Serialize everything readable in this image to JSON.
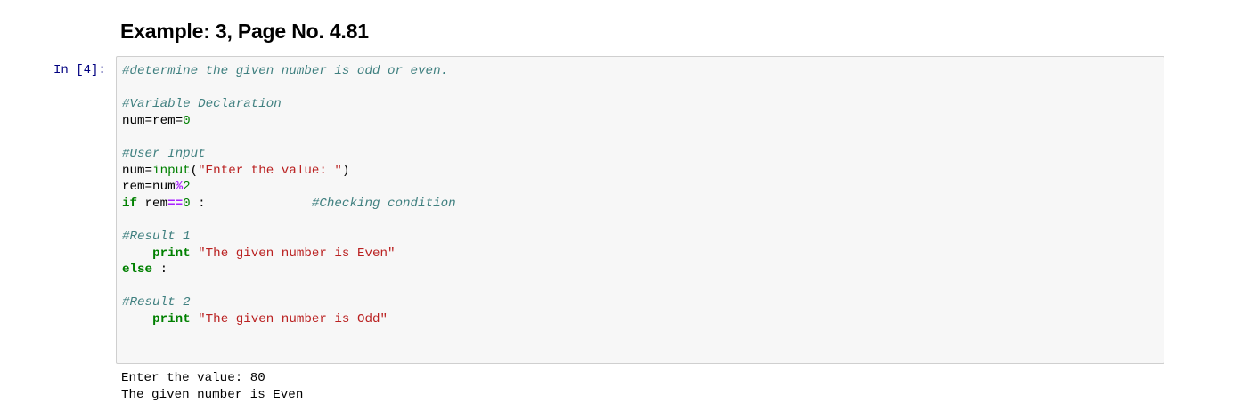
{
  "heading": "Example: 3, Page No. 4.81",
  "cell": {
    "prompt": "In [4]:",
    "code_lines": [
      [
        {
          "t": "c",
          "v": "#determine the given number is odd or even."
        }
      ],
      [],
      [
        {
          "t": "c",
          "v": "#Variable Declaration"
        }
      ],
      [
        {
          "t": "p",
          "v": "num=rem="
        },
        {
          "t": "m",
          "v": "0"
        }
      ],
      [],
      [
        {
          "t": "c",
          "v": "#User Input"
        }
      ],
      [
        {
          "t": "p",
          "v": "num="
        },
        {
          "t": "nb",
          "v": "input"
        },
        {
          "t": "p",
          "v": "("
        },
        {
          "t": "s",
          "v": "\"Enter the value: \""
        },
        {
          "t": "p",
          "v": ")"
        }
      ],
      [
        {
          "t": "p",
          "v": "rem=num"
        },
        {
          "t": "o",
          "v": "%"
        },
        {
          "t": "m",
          "v": "2"
        }
      ],
      [
        {
          "t": "k",
          "v": "if"
        },
        {
          "t": "p",
          "v": " rem"
        },
        {
          "t": "o",
          "v": "=="
        },
        {
          "t": "m",
          "v": "0"
        },
        {
          "t": "p",
          "v": " :              "
        },
        {
          "t": "c",
          "v": "#Checking condition"
        }
      ],
      [],
      [
        {
          "t": "c",
          "v": "#Result 1"
        }
      ],
      [
        {
          "t": "p",
          "v": "    "
        },
        {
          "t": "k",
          "v": "print"
        },
        {
          "t": "p",
          "v": " "
        },
        {
          "t": "s",
          "v": "\"The given number is Even\""
        }
      ],
      [
        {
          "t": "k",
          "v": "else"
        },
        {
          "t": "p",
          "v": " :"
        }
      ],
      [],
      [
        {
          "t": "c",
          "v": "#Result 2"
        }
      ],
      [
        {
          "t": "p",
          "v": "    "
        },
        {
          "t": "k",
          "v": "print"
        },
        {
          "t": "p",
          "v": " "
        },
        {
          "t": "s",
          "v": "\"The given number is Odd\""
        }
      ]
    ],
    "output_lines": [
      "Enter the value: 80",
      "The given number is Even"
    ]
  }
}
